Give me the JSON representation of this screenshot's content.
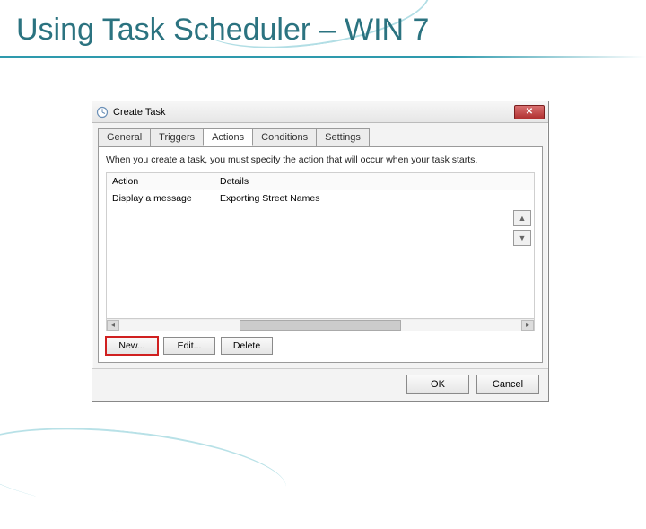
{
  "slide": {
    "title": "Using Task Scheduler – WIN 7"
  },
  "dialog": {
    "title": "Create Task",
    "tabs": [
      "General",
      "Triggers",
      "Actions",
      "Conditions",
      "Settings"
    ],
    "active_tab_index": 2,
    "instruction": "When you create a task, you must specify the action that will occur when your task starts.",
    "columns": {
      "action": "Action",
      "details": "Details"
    },
    "rows": [
      {
        "action": "Display a message",
        "details": "Exporting Street Names"
      }
    ],
    "buttons": {
      "new": "New...",
      "edit": "Edit...",
      "delete": "Delete",
      "ok": "OK",
      "cancel": "Cancel"
    },
    "arrows": {
      "up": "▲",
      "down": "▼"
    },
    "close_glyph": "✕"
  }
}
